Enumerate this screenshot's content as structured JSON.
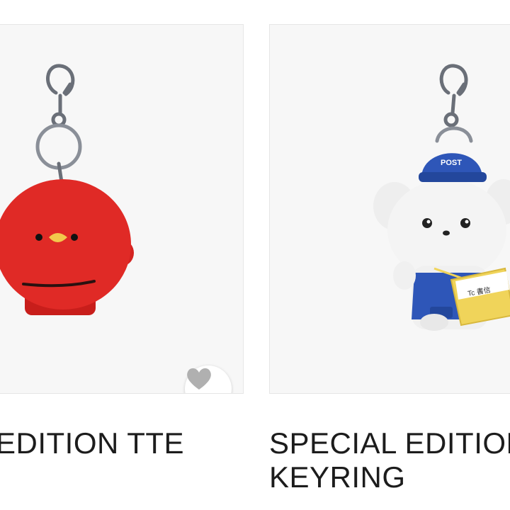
{
  "products": [
    {
      "image_name": "red-bird-plush-keyring",
      "title": "EDITION TTE",
      "wishlist_icon": "heart-icon"
    },
    {
      "image_name": "postman-bear-plush-keyring",
      "title": "SPECIAL EDITION KEYRING",
      "cap_text": "POST",
      "bag_text": "Tc 書信"
    }
  ],
  "colors": {
    "card_bg": "#f7f7f7",
    "plush_red": "#e02a26",
    "cap_blue": "#2e56b8",
    "bag_yellow": "#f0d45a",
    "heart_gray": "#b0b0b0"
  }
}
